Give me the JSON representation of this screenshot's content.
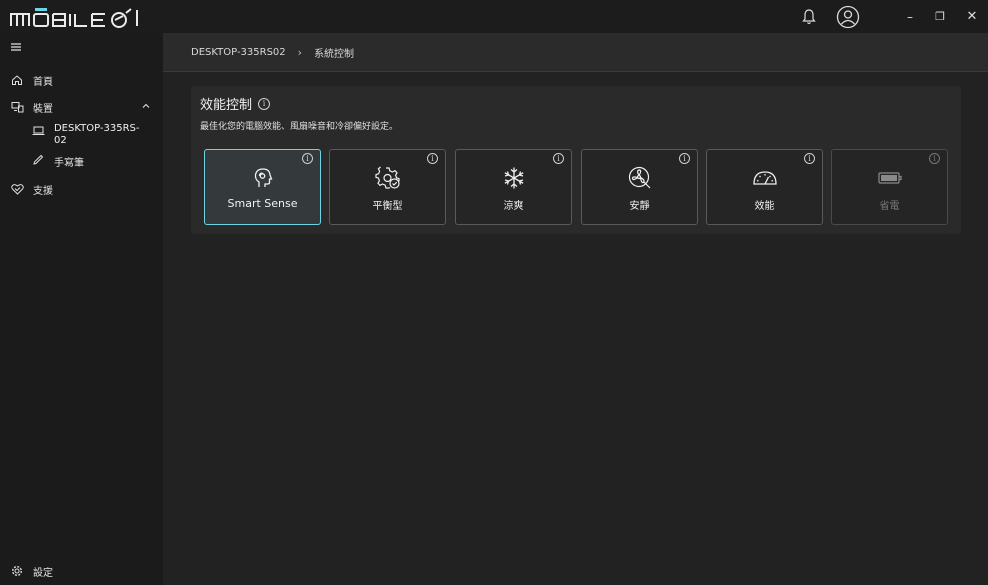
{
  "app": {
    "logo_text": "MOBILE01"
  },
  "window": {
    "minimize": "–",
    "maximize": "❐",
    "close": "✕"
  },
  "sidebar": {
    "items": [
      {
        "label": "首頁"
      },
      {
        "label": "裝置"
      },
      {
        "label": "支援"
      }
    ],
    "device_children": [
      {
        "label": "DESKTOP-335RS-02"
      },
      {
        "label": "手寫筆"
      }
    ],
    "settings_label": "設定"
  },
  "breadcrumb": {
    "items": [
      "DESKTOP-335RS02",
      "系統控制"
    ],
    "separator": "›"
  },
  "panel": {
    "title": "效能控制",
    "description": "最佳化您的電腦效能、風扇噪音和冷卻偏好設定。",
    "info_glyph": "i"
  },
  "modes": [
    {
      "label": "Smart Sense",
      "icon": "smart-sense-icon",
      "selected": true,
      "disabled": false
    },
    {
      "label": "平衡型",
      "icon": "balanced-gear-icon",
      "selected": false,
      "disabled": false
    },
    {
      "label": "涼爽",
      "icon": "snowflake-icon",
      "selected": false,
      "disabled": false
    },
    {
      "label": "安靜",
      "icon": "quiet-fan-icon",
      "selected": false,
      "disabled": false
    },
    {
      "label": "效能",
      "icon": "speedometer-icon",
      "selected": false,
      "disabled": false
    },
    {
      "label": "省電",
      "icon": "battery-icon",
      "selected": false,
      "disabled": true
    }
  ],
  "colors": {
    "accent": "#6fd3e6",
    "background": "#202020",
    "sidebar": "#1b1b1b",
    "panel": "#2a2a2a"
  }
}
